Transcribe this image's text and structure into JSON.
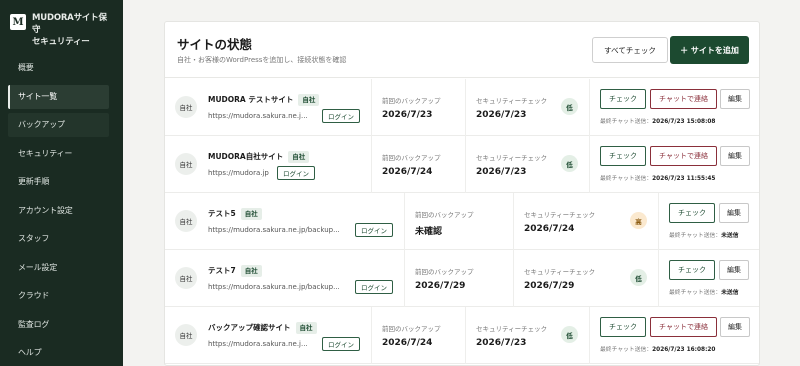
{
  "brand": {
    "logo": "M",
    "line1": "MUDORAサイト保守",
    "line2": "セキュリティー"
  },
  "nav": [
    "概要",
    "サイト一覧",
    "バックアップ",
    "セキュリティー",
    "更新手順",
    "アカウント設定",
    "スタッフ",
    "メール設定",
    "クラウド",
    "監査ログ",
    "ヘルプ"
  ],
  "panel": {
    "title": "サイトの状態",
    "subtitle": "自社・お客様のWordPressを追加し、接続状態を確認",
    "check_all": "すべてチェック",
    "add_site": "＋ サイトを追加"
  },
  "labels": {
    "backup": "前回のバックアップ",
    "security": "セキュリティーチェック",
    "check": "チェック",
    "chat": "チャットで連絡",
    "edit": "編集",
    "login": "ログイン",
    "self_badge": "自社",
    "chat_meta": "最終チャット送信："
  },
  "sites": [
    {
      "avatar": "自社",
      "name": "MUDORA テストサイト",
      "url": "https://mudora.sakura.ne.j...",
      "backup": "2026/7/23",
      "security": "2026/7/23",
      "level": "低",
      "chat_time": "2026/7/23 15:08:08"
    },
    {
      "avatar": "自社",
      "name": "MUDORA自社サイト",
      "url": "https://mudora.jp",
      "backup": "2026/7/24",
      "security": "2026/7/23",
      "level": "低",
      "chat_time": "2026/7/23 11:55:45"
    },
    {
      "avatar": "自社",
      "name": "テスト5",
      "url": "https://mudora.sakura.ne.jp/backup...",
      "backup": "未確認",
      "security": "2026/7/24",
      "level": "高",
      "chat_time": "未送信"
    },
    {
      "avatar": "自社",
      "name": "テスト7",
      "url": "https://mudora.sakura.ne.jp/backup...",
      "backup": "2026/7/29",
      "security": "2026/7/29",
      "level": "低",
      "chat_time": "未送信"
    },
    {
      "avatar": "自社",
      "name": "バックアップ確認サイト",
      "url": "https://mudora.sakura.ne.j...",
      "backup": "2026/7/24",
      "security": "2026/7/23",
      "level": "低",
      "chat_time": "2026/7/23 16:08:20"
    }
  ],
  "colors": {
    "sidebar": "#1a2b22",
    "accent": "#1c4a30",
    "chat": "#8a2f3a",
    "high": "#fbe9cf"
  }
}
